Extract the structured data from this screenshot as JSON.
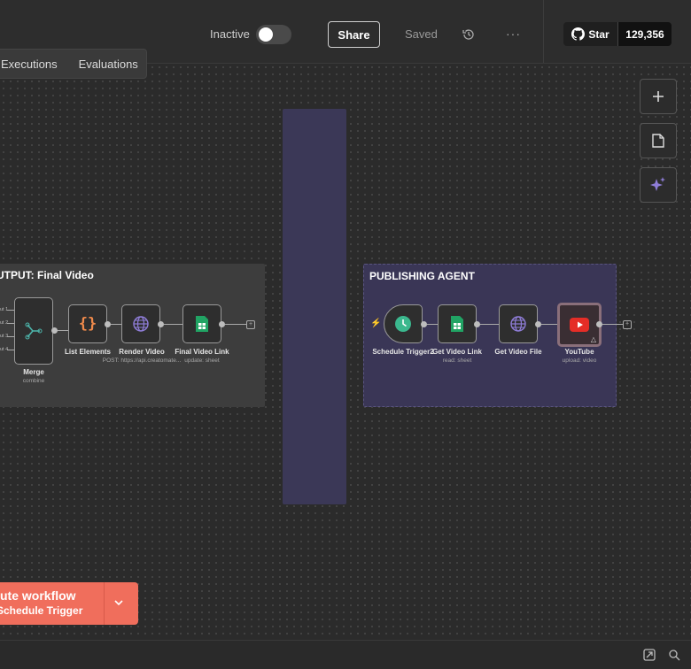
{
  "header": {
    "active_label": "Inactive",
    "share_label": "Share",
    "saved_label": "Saved",
    "more_label": "···",
    "github": {
      "star_label": "Star",
      "count": "129,356"
    }
  },
  "tabs": [
    {
      "label": "Executions"
    },
    {
      "label": "Evaluations"
    }
  ],
  "groups": {
    "output": {
      "title": "UTPUT: Final Video"
    },
    "publishing": {
      "title": "PUBLISHING AGENT"
    }
  },
  "nodes": {
    "merge": {
      "label": "Merge",
      "sub": "combine"
    },
    "list_elements": {
      "label": "List Elements",
      "sub": ""
    },
    "render_video": {
      "label": "Render Video",
      "sub": "POST: https://api.creatomate..."
    },
    "final_video_link": {
      "label": "Final Video Link",
      "sub": "update: sheet"
    },
    "schedule_trigger2": {
      "label": "Schedule Trigger2",
      "sub": ""
    },
    "get_video_link": {
      "label": "Get Video Link",
      "sub": "read: sheet"
    },
    "get_video_file": {
      "label": "Get Video File",
      "sub": ""
    },
    "youtube": {
      "label": "YouTube",
      "sub": "upload: video"
    }
  },
  "merge_inputs": [
    "ut 1",
    "ut 2",
    "ut 3",
    "ut 4"
  ],
  "execute": {
    "main_label": "ute workflow",
    "sub_label": "Schedule Trigger"
  },
  "colors": {
    "accent": "#f06e5c",
    "sticky": "#3b3857",
    "group_publishing": "#3a3656"
  },
  "icons": [
    "history-icon",
    "github-icon",
    "plus-icon",
    "sticky-note-icon",
    "sparkles-icon",
    "merge-icon",
    "braces-icon",
    "globe-icon",
    "sheets-icon",
    "clock-icon",
    "youtube-icon",
    "chevron-down-icon",
    "expand-icon",
    "zoom-icon"
  ]
}
